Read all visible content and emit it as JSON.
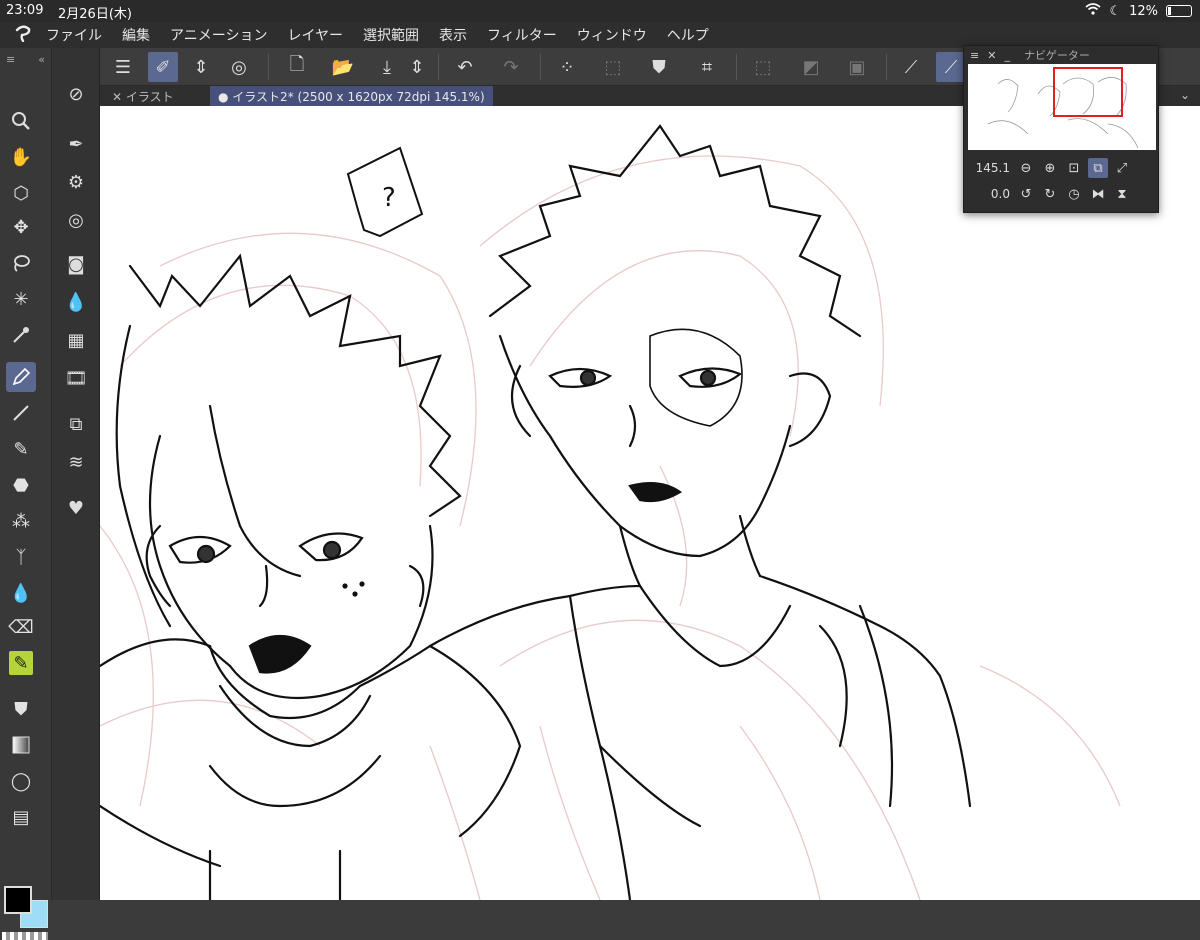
{
  "status": {
    "time": "23:09",
    "date": "2月26日(木)",
    "battery": "12%"
  },
  "menu": {
    "logo": "Clip Studio",
    "items": [
      "ファイル",
      "編集",
      "アニメーション",
      "レイヤー",
      "選択範囲",
      "表示",
      "フィルター",
      "ウィンドウ",
      "ヘルプ"
    ]
  },
  "tabs": [
    {
      "label": "イラスト",
      "active": false
    },
    {
      "label": "イラスト2* (2500 x 1620px 72dpi 145.1%)",
      "active": true
    }
  ],
  "navigator": {
    "title": "ナビゲーター",
    "zoom": "145.1",
    "rotation": "0.0"
  },
  "speech_bubble": "?",
  "colors": {
    "main": "#000000",
    "sub": "#9fdcf5",
    "accent": "#5b6890",
    "tool_highlight": "#b5d33c",
    "sketch": "#e9c9c9"
  }
}
